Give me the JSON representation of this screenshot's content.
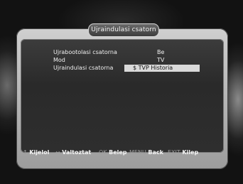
{
  "menu": {
    "title": "Ujraindulasi csatorn",
    "rows": [
      {
        "label": "Ujrabootolasi csatorna",
        "value": "Be"
      },
      {
        "label": "Mod",
        "value": "TV"
      },
      {
        "label": "Ujraindulasi csatorna",
        "value": "$ TVP Historia"
      }
    ]
  },
  "footer": {
    "select": {
      "key": "↕",
      "action": "Kijelol"
    },
    "change": {
      "key": "↔",
      "action": "Valtoztat"
    },
    "enter": {
      "key": "OK",
      "action": "Belep"
    },
    "back": {
      "key": "MENU",
      "action": "Back"
    },
    "exit": {
      "key": "EXIT",
      "action": "Kilep"
    }
  }
}
